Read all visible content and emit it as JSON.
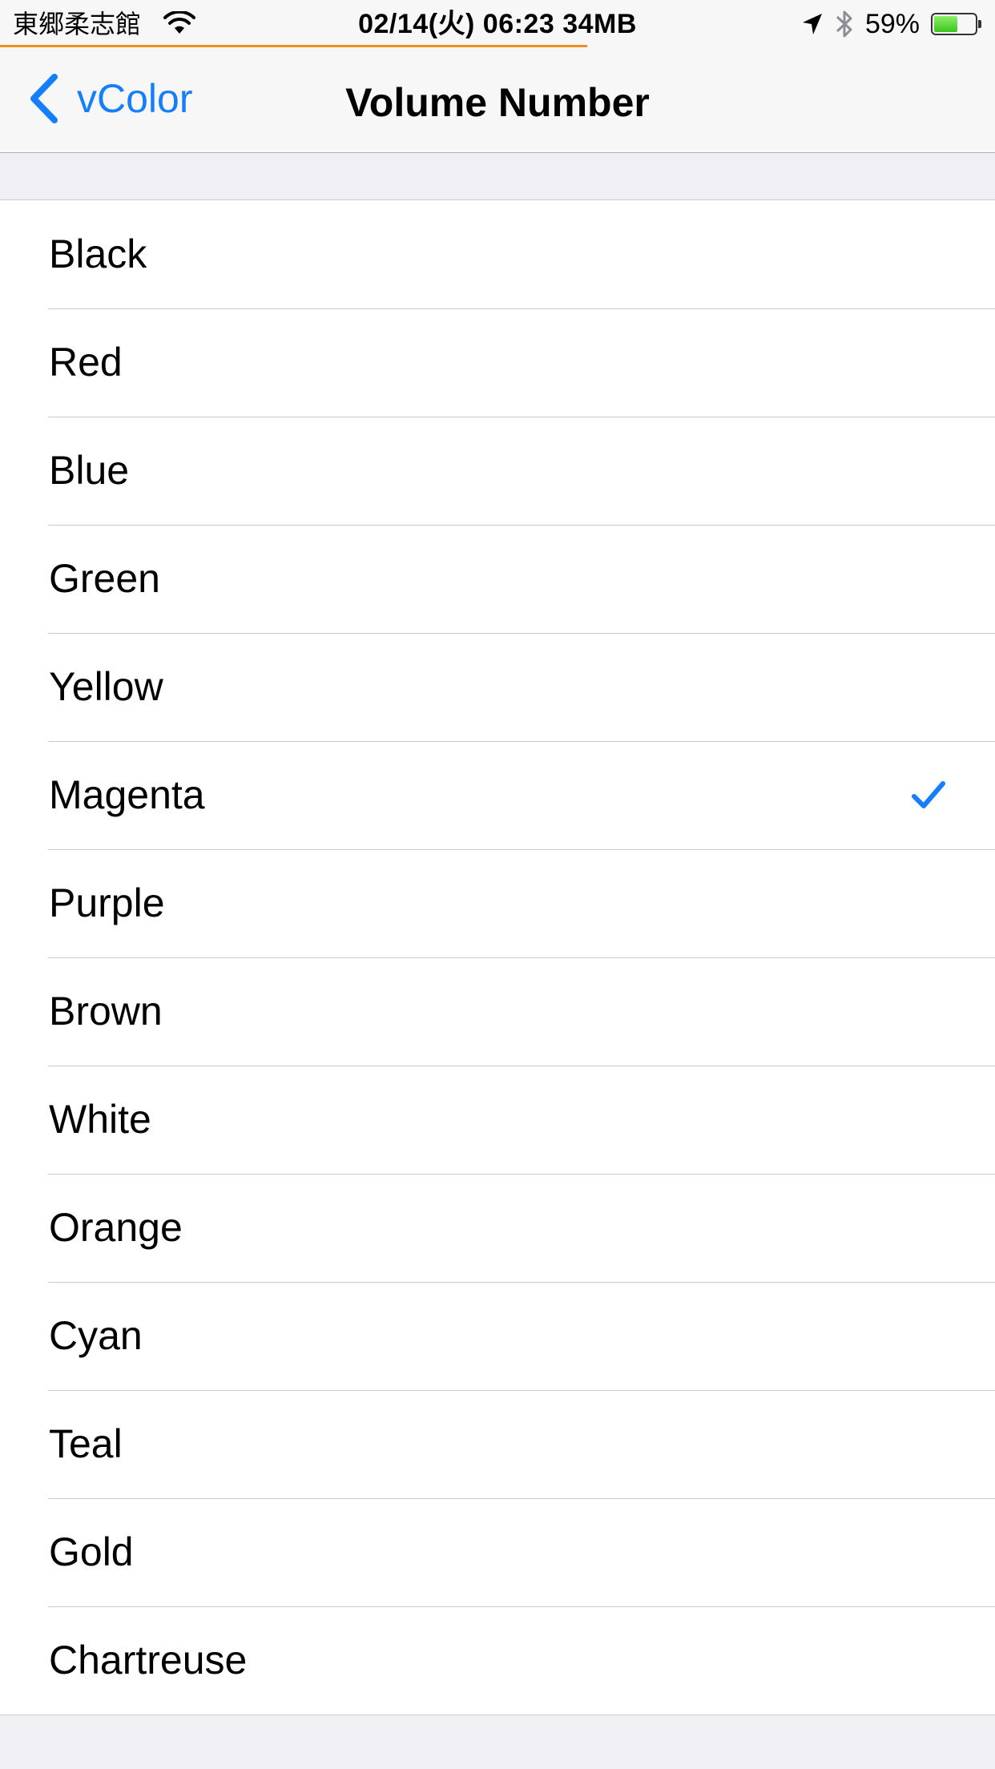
{
  "status_bar": {
    "carrier": "東郷柔志館",
    "clock": "02/14(火) 06:23 34MB",
    "battery_percent": "59%",
    "battery_level": 0.59,
    "page_load_progress": 0.59,
    "icons": [
      "wifi-icon",
      "location-arrow-icon",
      "bluetooth-icon",
      "battery-icon"
    ]
  },
  "nav": {
    "back_label": "vColor",
    "title": "Volume Number"
  },
  "colors": {
    "accent": "#157efb",
    "progress": "#f08c1c",
    "background": "#efeff4",
    "separator": "#c8c7cc"
  },
  "options": [
    {
      "label": "Black",
      "selected": false
    },
    {
      "label": "Red",
      "selected": false
    },
    {
      "label": "Blue",
      "selected": false
    },
    {
      "label": "Green",
      "selected": false
    },
    {
      "label": "Yellow",
      "selected": false
    },
    {
      "label": "Magenta",
      "selected": true
    },
    {
      "label": "Purple",
      "selected": false
    },
    {
      "label": "Brown",
      "selected": false
    },
    {
      "label": "White",
      "selected": false
    },
    {
      "label": "Orange",
      "selected": false
    },
    {
      "label": "Cyan",
      "selected": false
    },
    {
      "label": "Teal",
      "selected": false
    },
    {
      "label": "Gold",
      "selected": false
    },
    {
      "label": "Chartreuse",
      "selected": false
    }
  ]
}
